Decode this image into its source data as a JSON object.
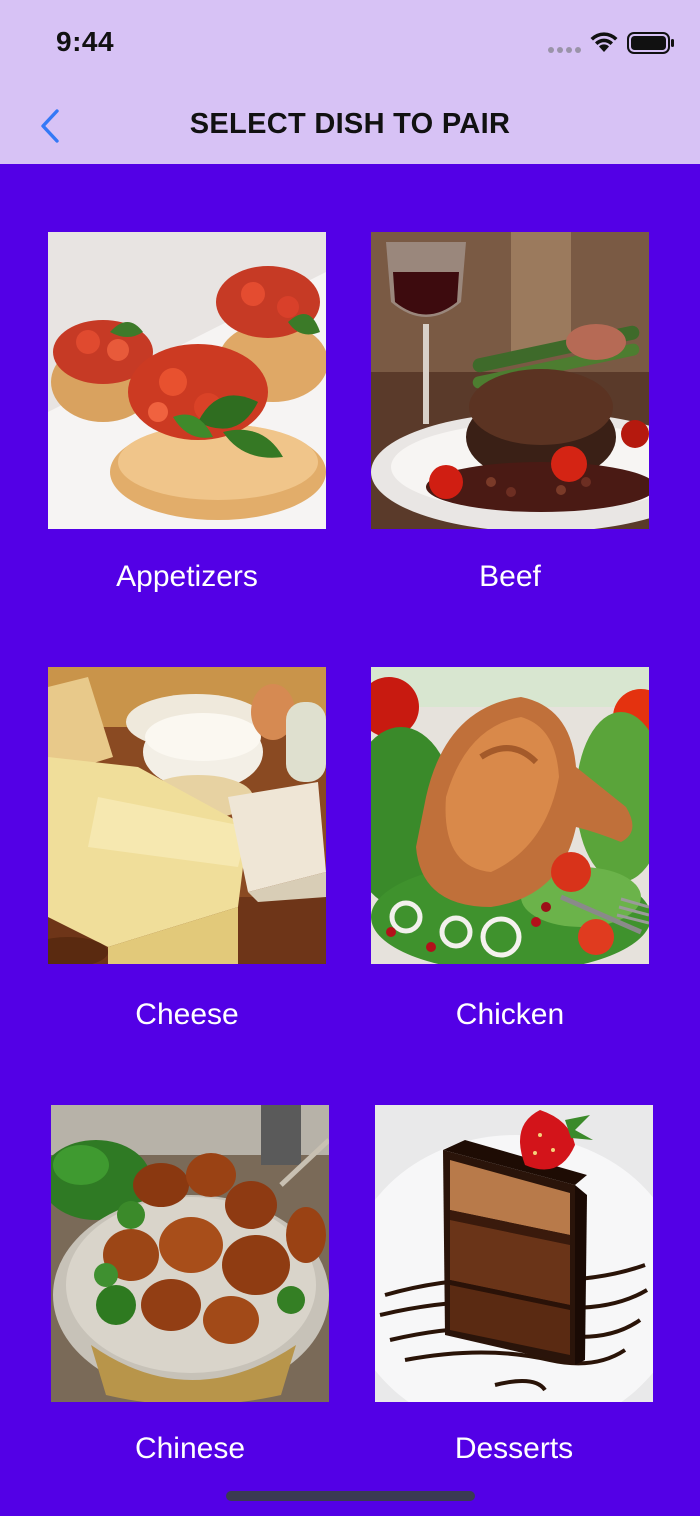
{
  "status_bar": {
    "time": "9:44"
  },
  "nav": {
    "title": "SELECT DISH TO PAIR",
    "back_icon": "chevron-left-icon",
    "accent_color": "#3478f6"
  },
  "colors": {
    "background": "#5300e6",
    "header_background": "#d7c2f5"
  },
  "dishes": [
    {
      "label": "Appetizers",
      "image": "appetizers-image"
    },
    {
      "label": "Beef",
      "image": "beef-image"
    },
    {
      "label": "Cheese",
      "image": "cheese-image"
    },
    {
      "label": "Chicken",
      "image": "chicken-image"
    },
    {
      "label": "Chinese",
      "image": "chinese-image"
    },
    {
      "label": "Desserts",
      "image": "desserts-image"
    }
  ]
}
